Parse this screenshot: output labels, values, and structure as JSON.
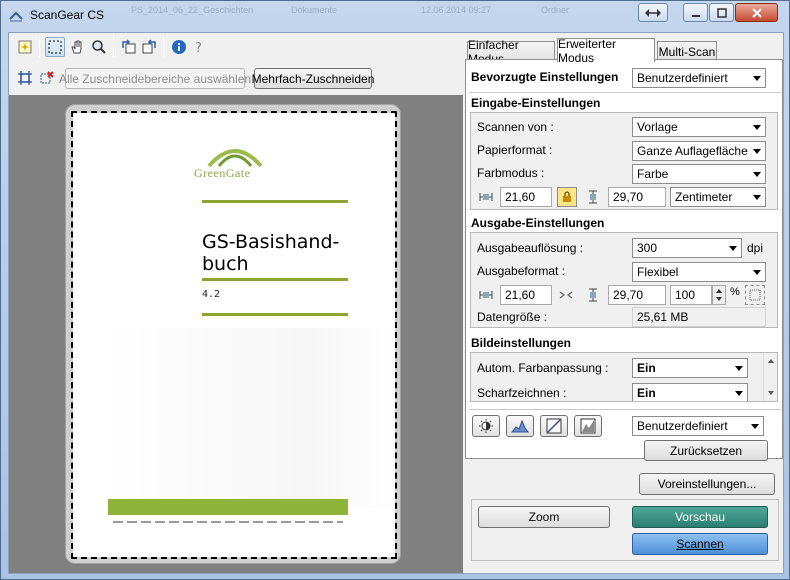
{
  "window": {
    "title": "ScanGear CS",
    "background_ghost_text": [
      "PS_2014_06_22_Geschichten",
      "Dokumente",
      "12.06.2014 09:27",
      "Ordner"
    ]
  },
  "left_toolbar": {
    "tools": [
      "auto-crop-icon",
      "crop-marquee-icon",
      "hand-icon",
      "zoom-icon",
      "rotate-left-icon",
      "rotate-right-icon",
      "info-icon",
      "help-icon"
    ],
    "select_all_crops_label": "Alle Zuschneidebereiche auswählen",
    "multi_crop_label": "Mehrfach-Zuschneiden"
  },
  "document": {
    "logo_text": "GreenGate",
    "title": "GS-Basishand-\nbuch",
    "version": "4.2"
  },
  "tabs": [
    {
      "label": "Einfacher Modus",
      "active": false
    },
    {
      "label": "Erweiterter Modus",
      "active": true
    },
    {
      "label": "Multi-Scan",
      "active": false
    }
  ],
  "preferred": {
    "label": "Bevorzugte Einstellungen",
    "value": "Benutzerdefiniert"
  },
  "input_settings": {
    "heading": "Eingabe-Einstellungen",
    "scan_from_label": "Scannen von :",
    "scan_from_value": "Vorlage",
    "paper_label": "Papierformat :",
    "paper_value": "Ganze Auflagefläche",
    "color_label": "Farbmodus :",
    "color_value": "Farbe",
    "width": "21,60",
    "height": "29,70",
    "unit": "Zentimeter"
  },
  "output_settings": {
    "heading": "Ausgabe-Einstellungen",
    "resolution_label": "Ausgabeauflösung :",
    "resolution_value": "300",
    "resolution_unit": "dpi",
    "format_label": "Ausgabeformat :",
    "format_value": "Flexibel",
    "width": "21,60",
    "height": "29,70",
    "scale": "100",
    "scale_unit": "%",
    "size_label": "Datengröße :",
    "size_value": "25,61 MB"
  },
  "image_settings": {
    "heading": "Bildeinstellungen",
    "auto_color_label": "Autom. Farbanpassung :",
    "auto_color_value": "Ein",
    "sharpen_label": "Scharfzeichnen :",
    "sharpen_value": "Ein"
  },
  "tone": {
    "preset_value": "Benutzerdefiniert",
    "reset_label": "Zurücksetzen"
  },
  "buttons": {
    "preferences": "Voreinstellungen...",
    "zoom": "Zoom",
    "preview": "Vorschau",
    "scan": "Scannen"
  },
  "colors": {
    "preview_btn": "#2f8a7c",
    "scan_btn": "#5d9fe0",
    "doc_green": "#8fb43a"
  }
}
